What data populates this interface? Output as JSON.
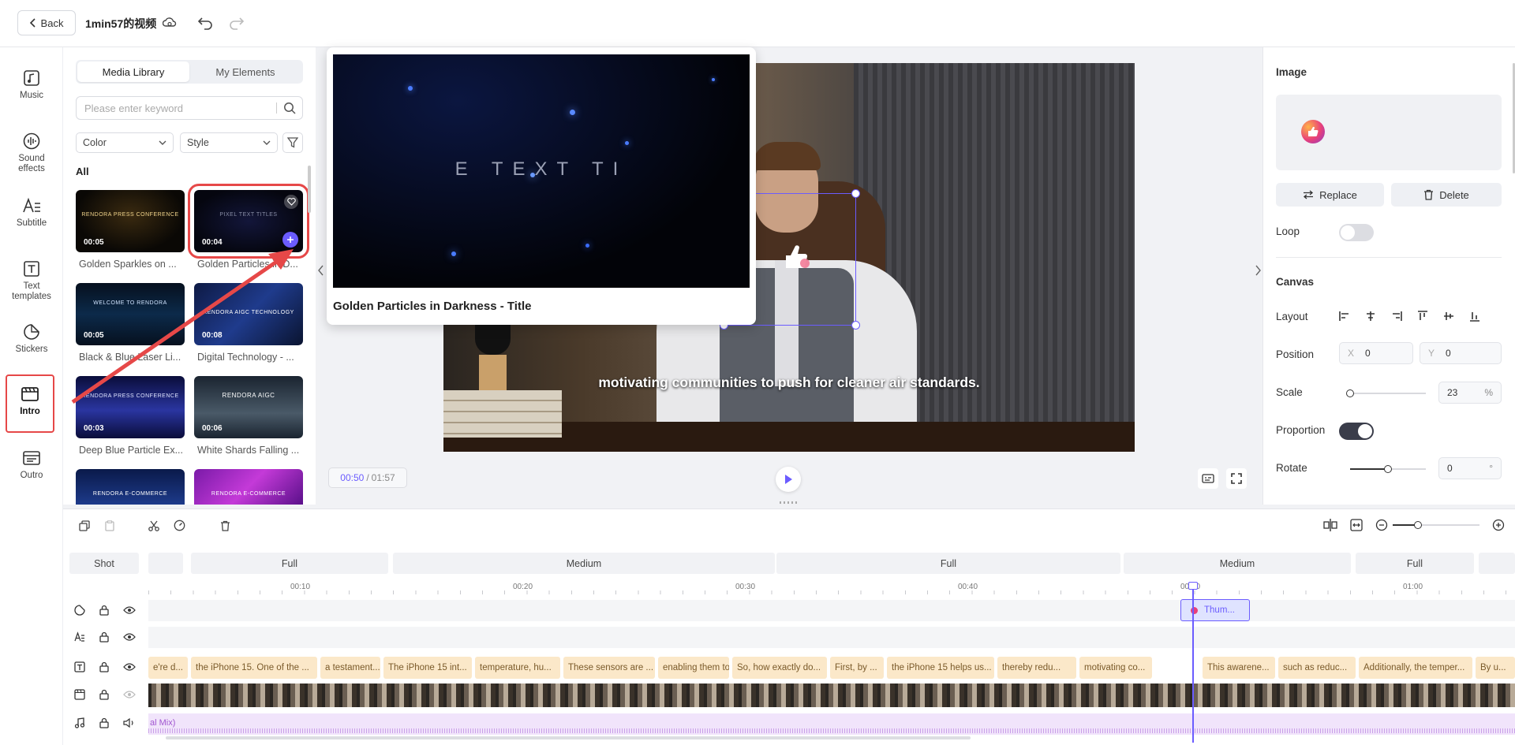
{
  "topbar": {
    "back_label": "Back",
    "project_title": "1min57的视频"
  },
  "nav": [
    {
      "label": "Music",
      "icon": "music-icon"
    },
    {
      "label": "Sound effects",
      "icon": "sound-effects-icon"
    },
    {
      "label": "Subtitle",
      "icon": "subtitle-icon"
    },
    {
      "label": "Text templates",
      "icon": "text-template-icon"
    },
    {
      "label": "Stickers",
      "icon": "sticker-icon"
    },
    {
      "label": "Intro",
      "icon": "intro-icon",
      "active": true
    },
    {
      "label": "Outro",
      "icon": "outro-icon"
    }
  ],
  "media": {
    "tabs": [
      "Media Library",
      "My Elements"
    ],
    "search_placeholder": "Please enter keyword",
    "filter_color": "Color",
    "filter_style": "Style",
    "section": "All",
    "items": [
      {
        "title": "Golden Sparkles on ...",
        "duration": "00:05",
        "overlay": "RENDORA PRESS CONFERENCE"
      },
      {
        "title": "Golden Particles in D...",
        "duration": "00:04",
        "overlay": "PIXEL TEXT TITLES"
      },
      {
        "title": "Black & Blue Laser Li...",
        "duration": "00:05",
        "overlay": "WELCOME TO RENDORA"
      },
      {
        "title": "Digital Technology - ...",
        "duration": "00:08",
        "overlay": "RENDORA AIGC TECHNOLOGY"
      },
      {
        "title": "Deep Blue Particle Ex...",
        "duration": "00:03",
        "overlay": "RENDORA PRESS CONFERENCE"
      },
      {
        "title": "White Shards Falling ...",
        "duration": "00:06",
        "overlay": "RENDORA AIGC"
      },
      {
        "title": "",
        "duration": "",
        "overlay": "RENDORA E-COMMERCE"
      },
      {
        "title": "",
        "duration": "",
        "overlay": "RENDORA E-COMMERCE"
      }
    ]
  },
  "popup": {
    "preview_text": "E  TEXT  TI",
    "title": "Golden Particles in Darkness - Title"
  },
  "preview": {
    "subtitle": "motivating communities to push for cleaner air standards.",
    "time_current": "00:50",
    "time_total": "01:57"
  },
  "props": {
    "image_label": "Image",
    "replace": "Replace",
    "delete": "Delete",
    "loop": "Loop",
    "canvas": "Canvas",
    "layout": "Layout",
    "position": "Position",
    "pos_x_label": "X",
    "pos_x": "0",
    "pos_y_label": "Y",
    "pos_y": "0",
    "scale": "Scale",
    "scale_value": "23",
    "scale_unit": "%",
    "proportion": "Proportion",
    "rotate": "Rotate",
    "rotate_value": "0",
    "rotate_unit": "°"
  },
  "timeline": {
    "shot_label": "Shot",
    "shots": [
      "Full",
      "Medium",
      "Full",
      "Medium",
      "Full"
    ],
    "ticks": [
      "00:10",
      "00:20",
      "00:30",
      "00:40",
      "00:50",
      "01:00"
    ],
    "sticker_clip": "Thum...",
    "audio_label": "al Mix)",
    "text_clips": [
      "e're d...",
      "the iPhone 15. One of the ...",
      "a testament...",
      "The iPhone 15 int...",
      "temperature, hu...",
      "These sensors are ...",
      "enabling them to...",
      "So, how exactly do...",
      "First, by ...",
      "the iPhone 15 helps us...",
      "thereby redu...",
      "motivating co...",
      "This awarene...",
      "such as reduc...",
      "Additionally, the temper...",
      "By u..."
    ]
  },
  "colors": {
    "accent": "#6b5cff",
    "danger": "#e64848",
    "clip": "#fbe8c9"
  }
}
